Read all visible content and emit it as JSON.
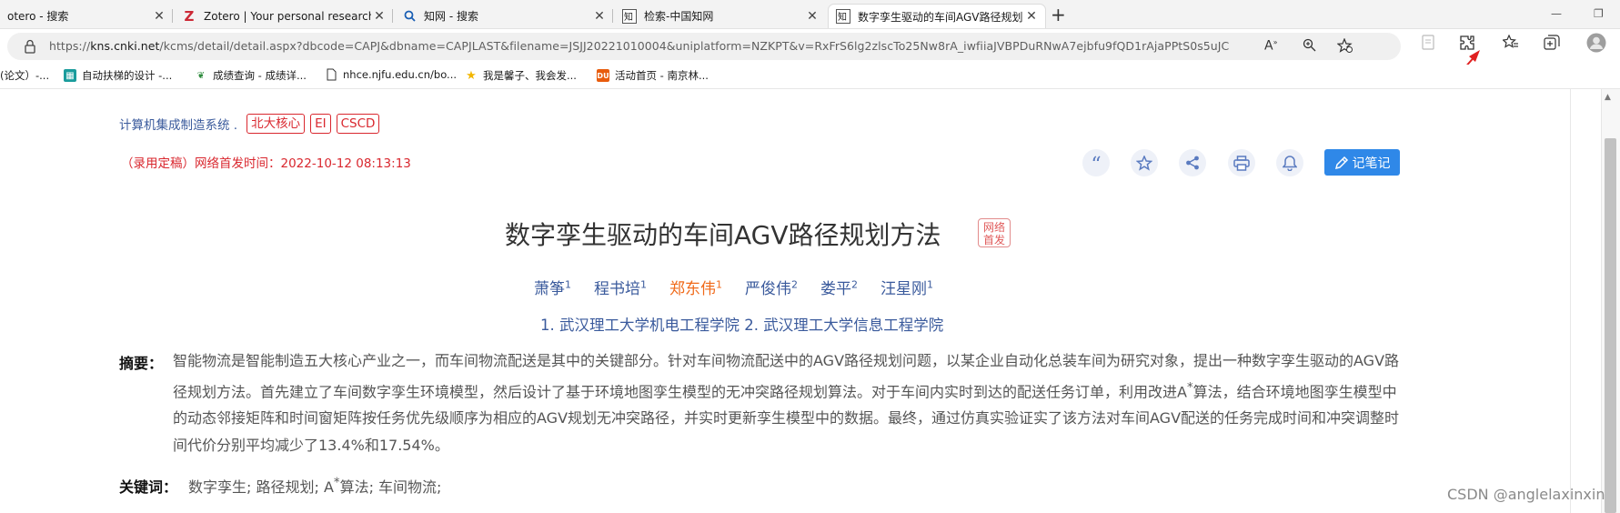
{
  "tabs": [
    {
      "title": "otero - 搜索",
      "icon": "",
      "icon_color": "#1b1b1b",
      "active": false
    },
    {
      "title": "Zotero | Your personal research a",
      "icon": "Z",
      "icon_color": "#cc2936",
      "active": false
    },
    {
      "title": "知网 - 搜索",
      "icon": "search-icon",
      "icon_color": "#1a5fb4",
      "active": false
    },
    {
      "title": "检索-中国知网",
      "icon": "cnki-icon",
      "icon_color": "#222222",
      "active": false
    },
    {
      "title": "数字孪生驱动的车间AGV路径规划",
      "icon": "cnki-icon",
      "icon_color": "#222222",
      "active": true
    }
  ],
  "new_tab_label": "+",
  "address": {
    "url_prefix": "https://",
    "url_host": "kns.cnki.net",
    "url_rest": "/kcms/detail/detail.aspx?dbcode=CAPJ&dbname=CAPJLAST&filename=JSJJ20221010004&uniplatform=NZKPT&v=RxFrS6lg2zlscTo25Nw8rA_iwfiiaJVBPDuRNwA7ejbfu9fQD1rAjaPPtS0s5uJC"
  },
  "bookmarks": [
    {
      "label": "(论文）-...",
      "icon": ""
    },
    {
      "label": "自动扶梯的设计 -...",
      "icon": "bookmark-icon"
    },
    {
      "label": "成绩查询 - 成绩详...",
      "icon": "leaf-icon"
    },
    {
      "label": "nhce.njfu.edu.cn/bo...",
      "icon": "page-icon"
    },
    {
      "label": "我是馨子、我会发...",
      "icon": "star-icon"
    },
    {
      "label": "活动首页 - 南京林...",
      "icon": "du-icon"
    }
  ],
  "paper": {
    "journal": "计算机集成制造系统 .",
    "badges": [
      "北大核心",
      "EI",
      "CSCD"
    ],
    "publish_time": "（录用定稿）网络首发时间：2022-10-12 08:13:13",
    "note_button": "记笔记",
    "title": "数字孪生驱动的车间AGV路径规划方法",
    "online_tag_line1": "网络",
    "online_tag_line2": "首发",
    "authors": [
      {
        "name": "萧筝",
        "sup": "1",
        "highlight": false
      },
      {
        "name": "程书培",
        "sup": "1",
        "highlight": false
      },
      {
        "name": "郑东伟",
        "sup": "1",
        "highlight": true
      },
      {
        "name": "严俊伟",
        "sup": "2",
        "highlight": false
      },
      {
        "name": "娄平",
        "sup": "2",
        "highlight": false
      },
      {
        "name": "汪星刚",
        "sup": "1",
        "highlight": false
      }
    ],
    "affiliations": "1. 武汉理工大学机电工程学院  2. 武汉理工大学信息工程学院",
    "abstract_label": "摘要：",
    "abstract_part1": "智能物流是智能制造五大核心产业之一，而车间物流配送是其中的关键部分。针对车间物流配送中的AGV路径规划问题，以某企业自动化总装车间为研究对象，提出一种数字孪生驱动的AGV路径规划方法。首先建立了车间数字孪生环境模型，然后设计了基于环境地图孪生模型的无冲突路径规划算法。对于车间内实时到达的配送任务订单，利用改进A",
    "abstract_sup": "*",
    "abstract_part2": "算法，结合环境地图孪生模型中的动态邻接矩阵和时间窗矩阵按任务优先级顺序为相应的AGV规划无冲突路径，并实时更新孪生模型中的数据。最终，通过仿真实验证实了该方法对车间AGV配送的任务完成时间和冲突调整时间代价分别平均减少了13.4%和17.54%。",
    "keywords_label": "关键词：",
    "keywords_a": "数字孪生;  路径规划;  A",
    "keywords_sup": "*",
    "keywords_b": "算法;  车间物流;"
  },
  "watermark": "CSDN @anglelaxinxin",
  "colors": {
    "accent": "#2f88e8",
    "badge_red": "#d9272e",
    "author_blue": "#3a5a9c",
    "author_highlight": "#f06a1a",
    "annotation_red": "#e02020"
  }
}
